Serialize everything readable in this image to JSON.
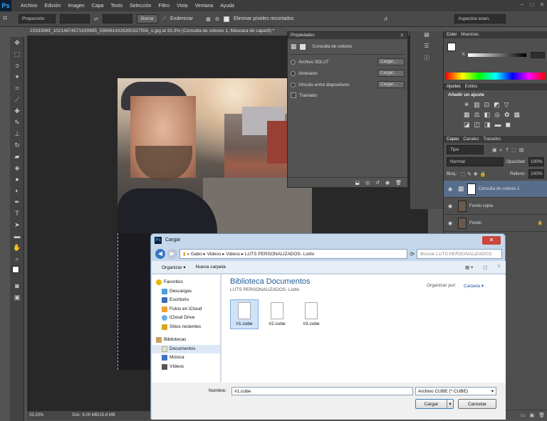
{
  "app": {
    "logo": "Ps",
    "menu": [
      "Archivo",
      "Edición",
      "Imagen",
      "Capa",
      "Texto",
      "Selección",
      "Filtro",
      "Vista",
      "Ventana",
      "Ayuda"
    ]
  },
  "options": {
    "style": "Proporción",
    "clear": "Borrar",
    "straighten": "Enderezar",
    "delete_pixels": "Eliminar píxeles recortados",
    "workspace": "Aspectos esen."
  },
  "document": {
    "tab": "23333969_10214874571639985_5369614326350327556_o.jpg al 33,3% (Consulta de colores 1, Máscara de capa/8) *",
    "zoom": "33,33%",
    "doc": "Doc: 8,00 MB/15,8 MB"
  },
  "properties": {
    "title": "Propiedades",
    "layer": "Consulta de colores",
    "options": [
      {
        "label": "Archivo 3DLUT",
        "btn": "Cargar..."
      },
      {
        "label": "Abstracto",
        "btn": "Cargar..."
      },
      {
        "label": "Vínculo entre dispositivos",
        "btn": "Cargar..."
      }
    ],
    "dither": "Tramado"
  },
  "color_panel": {
    "tabs": [
      "Color",
      "Muestras"
    ],
    "k": "K"
  },
  "adjust_panel": {
    "tabs": [
      "Ajustes",
      "Estilos"
    ],
    "heading": "Añadir un ajuste"
  },
  "layers_panel": {
    "tabs": [
      "Capas",
      "Canales",
      "Trazados"
    ],
    "kind": "Tipo",
    "blend": "Normal",
    "opacity_label": "Opacidad:",
    "opacity": "100%",
    "lock_label": "Bloq.:",
    "fill_label": "Relleno:",
    "fill": "100%",
    "layers": [
      "Consulta de colores 1",
      "Fondo copia",
      "Fondo"
    ]
  },
  "dialog": {
    "title": "Cargar",
    "path": [
      "Gabo",
      "Videos",
      "Videos",
      "LUTS PERSONALIZADOS- Listto"
    ],
    "search": "Buscar LUTS PERSONALIZADOS- Listto",
    "organize": "Organizar",
    "new_folder": "Nueva carpeta",
    "nav": {
      "favorites": "Favoritos",
      "fav_items": [
        "Descargas",
        "Escritorio",
        "Fotos en iCloud",
        "iCloud Drive",
        "Sitios recientes"
      ],
      "libraries": "Bibliotecas",
      "lib_items": [
        "Documentos",
        "Música",
        "Vídeos"
      ]
    },
    "library_title": "Biblioteca Documentos",
    "library_sub": "LUTS PERSONALIZADOS- Listto",
    "organize_by": "Organizar por:",
    "organize_by_value": "Carpeta",
    "files": [
      "#1.cube",
      "#2.cube",
      "#3.cube"
    ],
    "name_label": "Nombre:",
    "name_value": "#1.cube",
    "filter": "Archivo CUBE (*.CUBE)",
    "open": "Cargar",
    "cancel": "Cancelar"
  },
  "colors": {
    "accent": "#31a8ff",
    "selected_layer": "#576d8a"
  }
}
